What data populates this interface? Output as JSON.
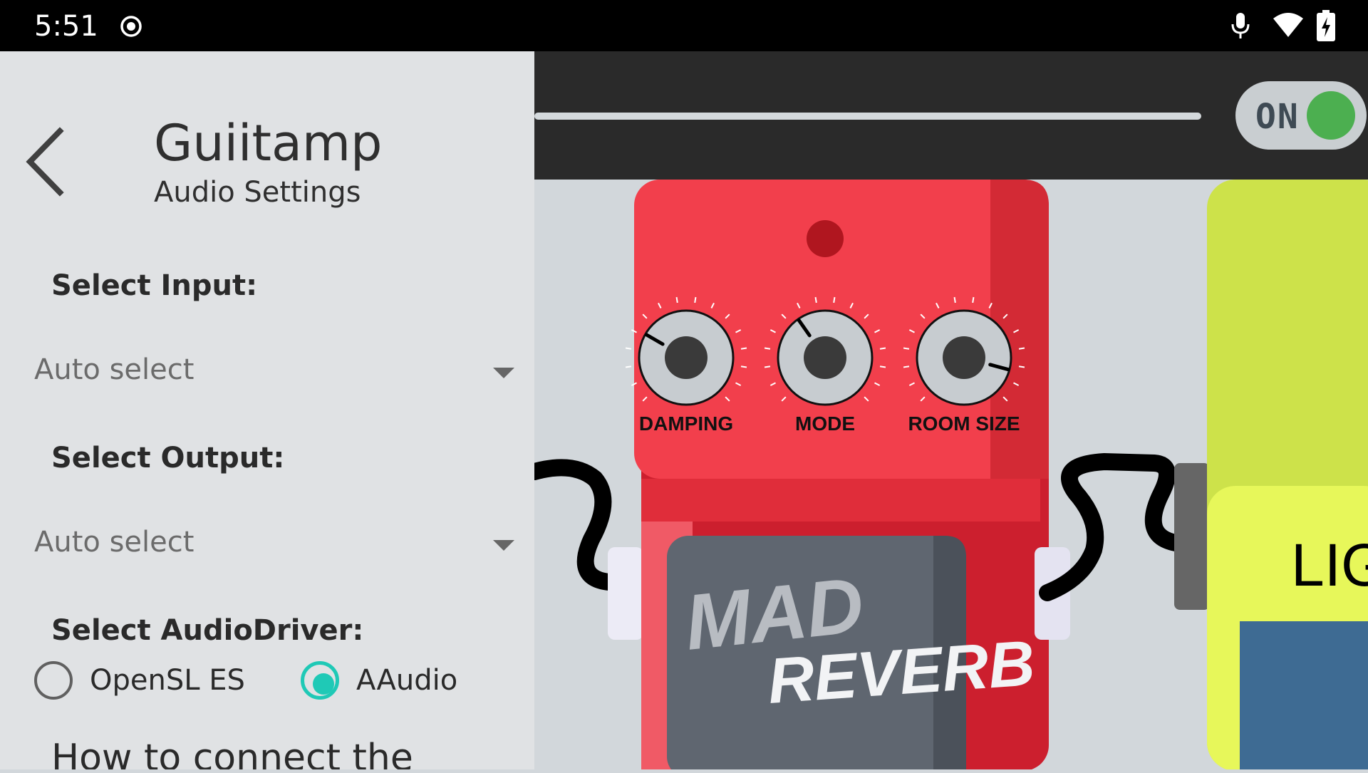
{
  "status_bar": {
    "time": "5:51",
    "icons": [
      "record-icon",
      "mic-icon",
      "wifi-icon",
      "battery-charging-icon"
    ]
  },
  "settings_panel": {
    "title": "Guiitamp",
    "subtitle": "Audio Settings",
    "input_label": "Select Input:",
    "input_value": "Auto select",
    "output_label": "Select Output:",
    "output_value": "Auto select",
    "driver_label": "Select AudioDriver:",
    "driver_options": [
      {
        "label": "OpenSL ES",
        "selected": false
      },
      {
        "label": "AAudio",
        "selected": true
      }
    ],
    "help_heading": "How to connect the"
  },
  "app": {
    "power_toggle": {
      "label": "ON",
      "on": true
    },
    "reverb_pedal": {
      "knobs": [
        {
          "label": "DAMPING"
        },
        {
          "label": "MODE"
        },
        {
          "label": "ROOM SIZE"
        }
      ],
      "logo_line1": "MAD",
      "logo_line2": "REVERB"
    },
    "next_pedal": {
      "logo_partial": "LIGI"
    }
  },
  "colors": {
    "accent": "#1fc9b6",
    "toggle_on": "#4caf50",
    "reverb_red": "#f23f4c",
    "next_pedal_green": "#e7f75a"
  }
}
